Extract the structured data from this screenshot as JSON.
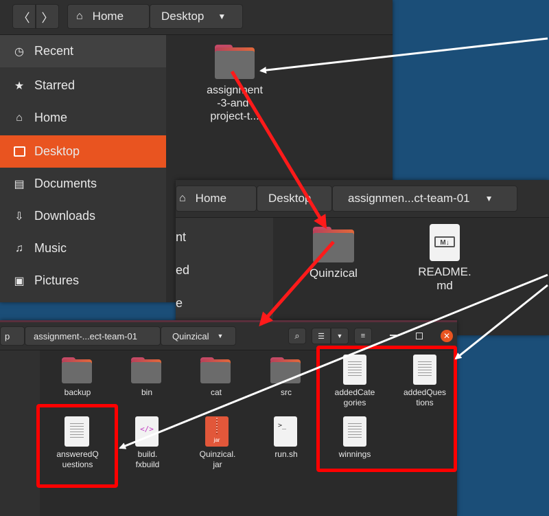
{
  "window1": {
    "breadcrumbs": [
      "Home",
      "Desktop"
    ],
    "sidebar": [
      {
        "label": "Recent",
        "icon": "clock-icon"
      },
      {
        "label": "Starred",
        "icon": "star-icon"
      },
      {
        "label": "Home",
        "icon": "home-icon"
      },
      {
        "label": "Desktop",
        "icon": "desktop-icon",
        "active": true
      },
      {
        "label": "Documents",
        "icon": "document-icon"
      },
      {
        "label": "Downloads",
        "icon": "download-icon"
      },
      {
        "label": "Music",
        "icon": "music-icon"
      },
      {
        "label": "Pictures",
        "icon": "picture-icon"
      }
    ],
    "folder_label": "assignment\n-3-and-\nproject-t..."
  },
  "window2": {
    "breadcrumbs": [
      "Home",
      "Desktop",
      "assignmen...ct-team-01"
    ],
    "sidebar_partial": [
      "nt",
      "ed",
      "e"
    ],
    "items": [
      {
        "label": "Quinzical",
        "type": "folder"
      },
      {
        "label": "README.\nmd",
        "type": "markdown"
      }
    ],
    "md_badge": "M↓"
  },
  "window3": {
    "breadcrumbs": [
      "p",
      "assignment-...ect-team-01",
      "Quinzical"
    ],
    "items": [
      {
        "label": "backup",
        "type": "folder"
      },
      {
        "label": "bin",
        "type": "folder"
      },
      {
        "label": "cat",
        "type": "folder"
      },
      {
        "label": "src",
        "type": "folder"
      },
      {
        "label": "addedCate\ngories",
        "type": "text"
      },
      {
        "label": "addedQues\ntions",
        "type": "text"
      },
      {
        "label": "answeredQ\nuestions",
        "type": "text"
      },
      {
        "label": "build.\nfxbuild",
        "type": "xml"
      },
      {
        "label": "Quinzical.\njar",
        "type": "jar"
      },
      {
        "label": "run.sh",
        "type": "script"
      },
      {
        "label": "winnings",
        "type": "text"
      }
    ],
    "jar_badge": "jar",
    "xml_badge": "</>",
    "script_badge": ">_"
  },
  "colors": {
    "accent": "#e95420",
    "annotation": "#ff0000",
    "desktop": "#1b4e78"
  }
}
